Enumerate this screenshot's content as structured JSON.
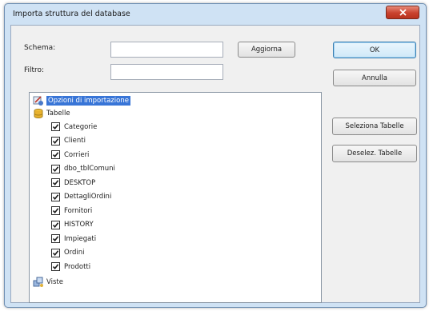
{
  "window": {
    "title": "Importa struttura del database"
  },
  "form": {
    "schema_label": "Schema:",
    "schema_value": "",
    "filter_label": "Filtro:",
    "filter_value": "",
    "refresh_label": "Aggiorna"
  },
  "buttons": {
    "ok": "OK",
    "cancel": "Annulla",
    "select_tables": "Seleziona Tabelle",
    "deselect_tables": "Deselez. Tabelle"
  },
  "tree": {
    "options_label": "Opzioni di importazione",
    "tables_label": "Tabelle",
    "tables": [
      {
        "name": "Categorie",
        "checked": true
      },
      {
        "name": "Clienti",
        "checked": true
      },
      {
        "name": "Corrieri",
        "checked": true
      },
      {
        "name": "dbo_tblComuni",
        "checked": true
      },
      {
        "name": "DESKTOP",
        "checked": true
      },
      {
        "name": "DettagliOrdini",
        "checked": true
      },
      {
        "name": "Fornitori",
        "checked": true
      },
      {
        "name": "HISTORY",
        "checked": true
      },
      {
        "name": "Impiegati",
        "checked": true
      },
      {
        "name": "Ordini",
        "checked": true
      },
      {
        "name": "Prodotti",
        "checked": true
      }
    ],
    "views_label": "Viste"
  },
  "icons": {
    "close": "close-icon",
    "options": "options-icon",
    "tables": "database-icon",
    "views": "views-icon",
    "checkbox": "checkbox-checked-icon"
  },
  "colors": {
    "frame": "#cfe2f4",
    "dialog_bg": "#f0f0f0",
    "selection": "#3875d7",
    "close_button": "#c9422e"
  }
}
